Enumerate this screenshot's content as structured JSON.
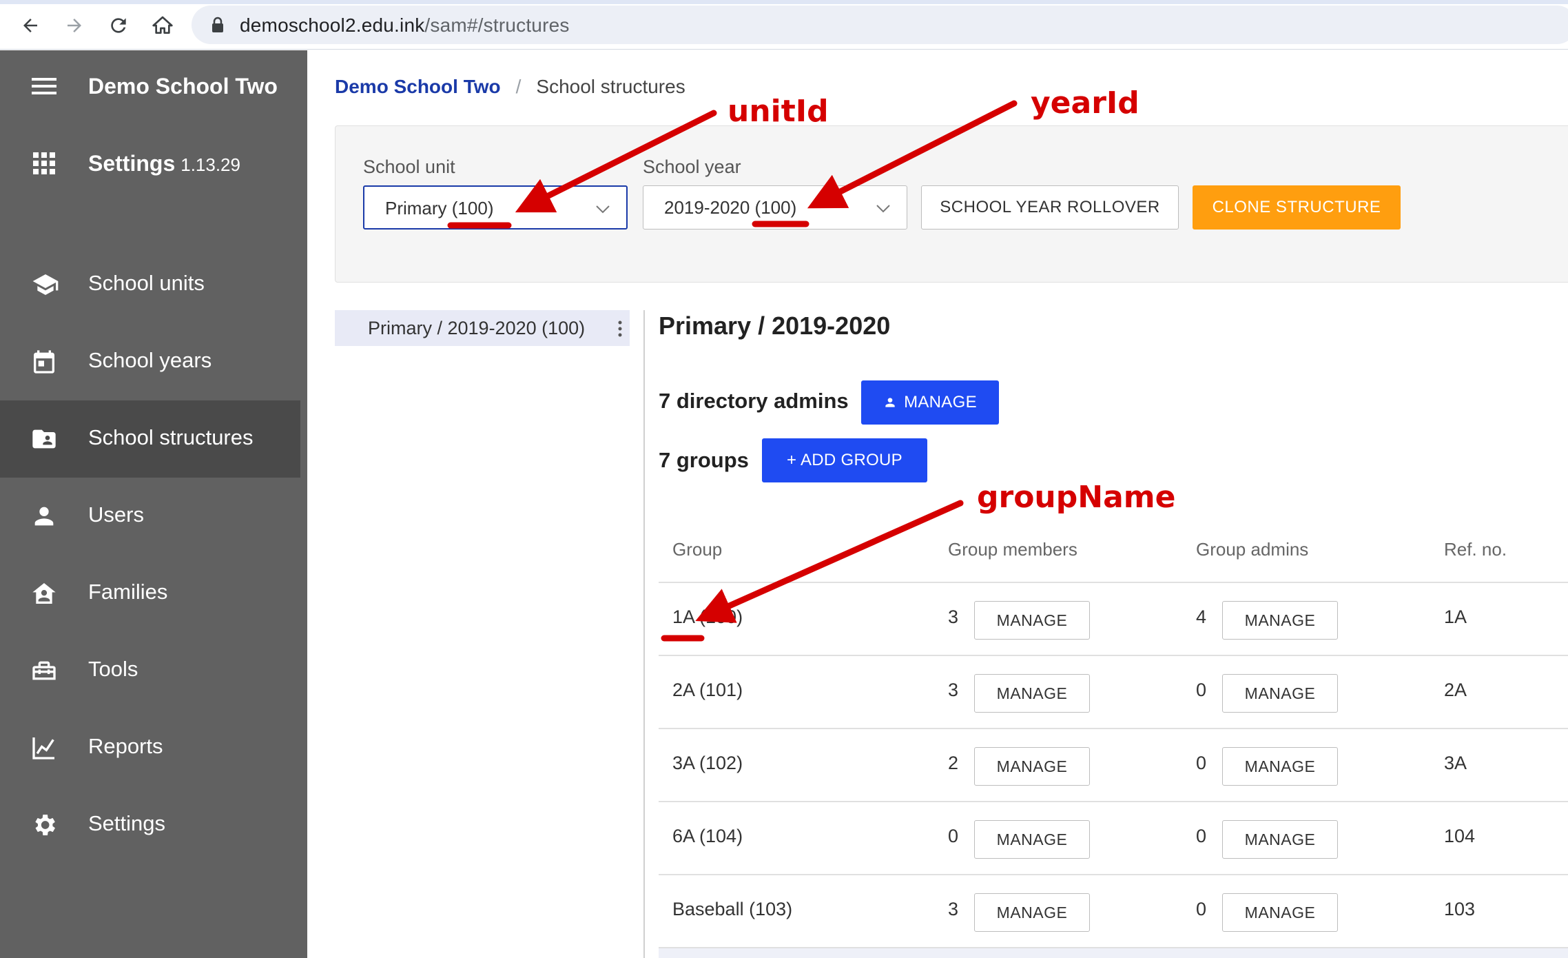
{
  "browser": {
    "url_host": "demoschool2.edu.ink",
    "url_path": "/sam#/structures"
  },
  "sidebar": {
    "school_name": "Demo School Two",
    "settings_title": "Settings",
    "version": "1.13.29",
    "items": [
      {
        "label": "School units",
        "icon": "school-cap-icon"
      },
      {
        "label": "School years",
        "icon": "calendar-icon"
      },
      {
        "label": "School structures",
        "icon": "folder-shared-icon",
        "active": true
      },
      {
        "label": "Users",
        "icon": "person-icon"
      },
      {
        "label": "Families",
        "icon": "family-icon"
      },
      {
        "label": "Tools",
        "icon": "toolbox-icon"
      },
      {
        "label": "Reports",
        "icon": "chart-line-icon"
      },
      {
        "label": "Settings",
        "icon": "gear-icon"
      }
    ]
  },
  "breadcrumb": {
    "home": "Demo School Two",
    "separator": "/",
    "current": "School structures"
  },
  "filters": {
    "unit_label": "School unit",
    "unit_value": "Primary (100)",
    "year_label": "School year",
    "year_value": "2019-2020 (100)",
    "rollover_button": "SCHOOL YEAR ROLLOVER",
    "clone_button": "CLONE STRUCTURE"
  },
  "tree": {
    "item": "Primary / 2019-2020 (100)"
  },
  "structure": {
    "title": "Primary / 2019-2020",
    "admins_label": "7 directory admins",
    "manage_button": "MANAGE",
    "groups_label": "7 groups",
    "add_group_button": "+ ADD GROUP"
  },
  "table": {
    "headers": {
      "group": "Group",
      "members": "Group members",
      "admins": "Group admins",
      "ref": "Ref. no."
    },
    "manage_label": "MANAGE",
    "rows": [
      {
        "group": "1A (100)",
        "members": "3",
        "admins": "4",
        "ref": "1A"
      },
      {
        "group": "2A (101)",
        "members": "3",
        "admins": "0",
        "ref": "2A"
      },
      {
        "group": "3A (102)",
        "members": "2",
        "admins": "0",
        "ref": "3A"
      },
      {
        "group": "6A (104)",
        "members": "0",
        "admins": "0",
        "ref": "104"
      },
      {
        "group": "Baseball (103)",
        "members": "3",
        "admins": "0",
        "ref": "103"
      }
    ]
  },
  "annotations": {
    "unit_id": "unitId",
    "year_id": "yearId",
    "group_name": "groupName",
    "color": "#d50000"
  },
  "colors": {
    "sidebar_bg": "#616161",
    "sidebar_active": "#4a4a4a",
    "primary_blue": "#1f4bf2",
    "orange": "#ff9e0f",
    "breadcrumb_link": "#1a3aa8"
  }
}
